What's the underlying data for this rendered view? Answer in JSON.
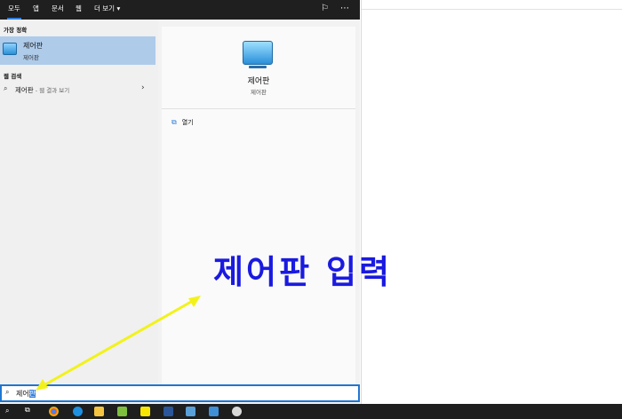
{
  "tabs": [
    {
      "label": "모두"
    },
    {
      "label": "앱"
    },
    {
      "label": "문서"
    },
    {
      "label": "웹"
    },
    {
      "label": "더 보기"
    }
  ],
  "sections": {
    "best_match": "가장 정확",
    "web_search": "웹 검색"
  },
  "best_match": {
    "title": "제어판",
    "subtitle": "제어판"
  },
  "web_result": {
    "query": "제어판",
    "suffix": " - 웹 결과 보기"
  },
  "detail": {
    "title": "제어판",
    "subtitle": "제어판",
    "open_label": "열기"
  },
  "search": {
    "typed": "제어",
    "selected": "판"
  },
  "annotation": {
    "text": "제어판 입력",
    "color": "#1a1ae0",
    "arrow_color": "#f2f21a"
  },
  "colors": {
    "accent": "#2f7ddf",
    "selection": "#aecbea",
    "taskbar": "#1e1e1e"
  },
  "taskbar_icons": [
    "chrome-icon",
    "edge-icon",
    "file-explorer-icon",
    "paint-icon",
    "kakaotalk-icon",
    "word-icon",
    "sticky-notes-icon",
    "control-panel-icon",
    "app-icon"
  ]
}
